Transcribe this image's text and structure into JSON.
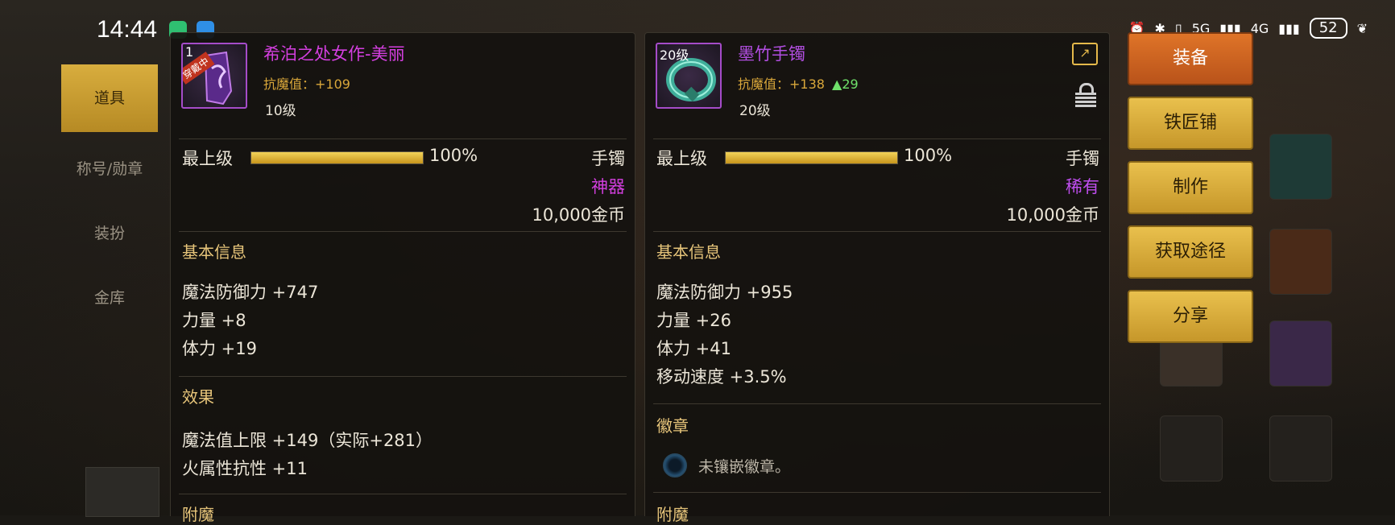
{
  "status_bar": {
    "time": "14:44",
    "network_1": "5G",
    "network_2": "4G",
    "battery": "52"
  },
  "left_tabs": [
    "道具",
    "称号/勋章",
    "装扮",
    "金库"
  ],
  "item1": {
    "level_badge": "1",
    "equipped_tag": "穿戴中",
    "name": "希泊之处女作-美丽",
    "name_color": "#d43fe0",
    "resist_stat": "抗魔值：+109",
    "level": "10级",
    "grade_label": "最上级",
    "grade_percent": "100%",
    "grade_fraction": 1.0,
    "type": "手镯",
    "rarity": "神器",
    "rarity_color": "#d43fe0",
    "price": "10,000金币",
    "basic_title": "基本信息",
    "basic_lines": [
      "魔法防御力 +747",
      "力量 +8",
      "体力 +19"
    ],
    "effect_title": "效果",
    "effect_lines": [
      "魔法值上限 +149（实际+281）",
      "火属性抗性 +11"
    ],
    "enchant_title": "附魔"
  },
  "item2": {
    "level_badge": "20级",
    "name": "墨竹手镯",
    "name_color": "#b14ee0",
    "resist_stat": "抗魔值：+138",
    "resist_up": "▲29",
    "level": "20级",
    "grade_label": "最上级",
    "grade_percent": "100%",
    "grade_fraction": 1.0,
    "type": "手镯",
    "rarity": "稀有",
    "rarity_color": "#c04ef0",
    "price": "10,000金币",
    "basic_title": "基本信息",
    "basic_lines": [
      "魔法防御力 +955",
      "力量 +26",
      "体力 +41",
      "移动速度 +3.5%"
    ],
    "emblem_title": "徽章",
    "emblem_empty": "未镶嵌徽章。",
    "enchant_title": "附魔"
  },
  "actions": [
    "装备",
    "铁匠铺",
    "制作",
    "获取途径",
    "分享"
  ],
  "colors": {
    "gold": "#d9a73a",
    "up_green": "#6fe06a"
  }
}
